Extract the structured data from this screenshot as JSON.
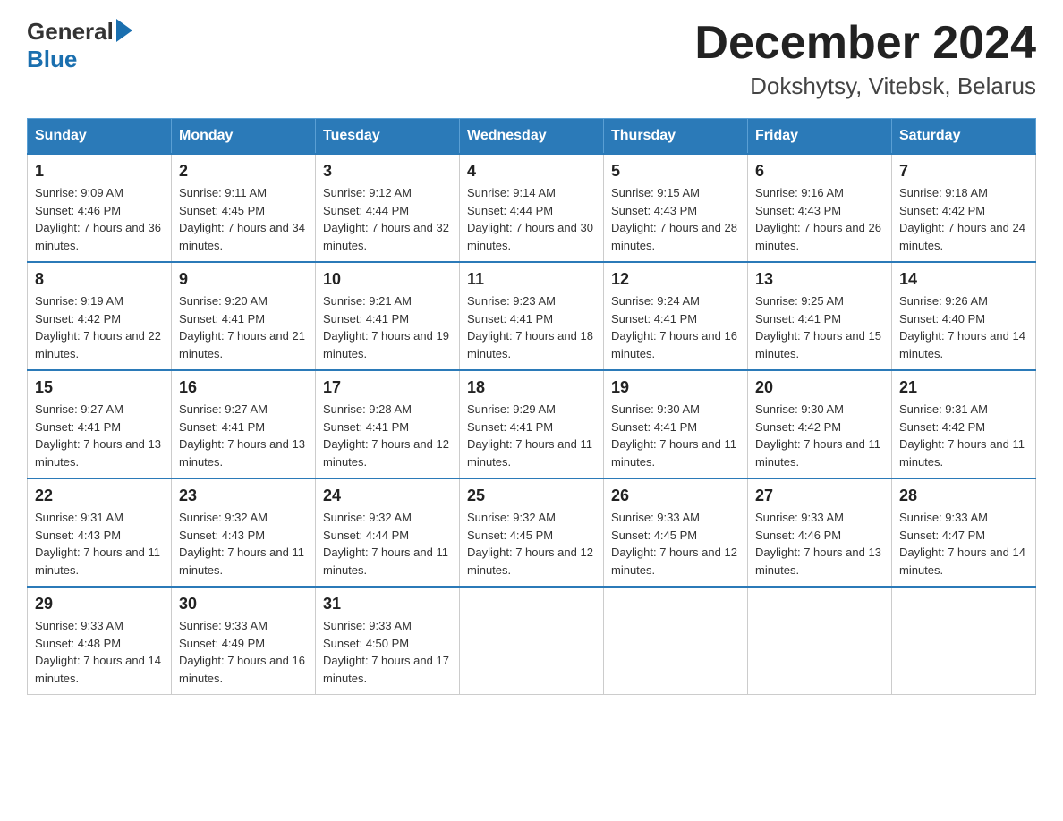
{
  "header": {
    "logo": {
      "general": "General",
      "blue": "Blue"
    },
    "month": "December 2024",
    "location": "Dokshytsy, Vitebsk, Belarus"
  },
  "weekdays": [
    "Sunday",
    "Monday",
    "Tuesday",
    "Wednesday",
    "Thursday",
    "Friday",
    "Saturday"
  ],
  "weeks": [
    [
      {
        "day": "1",
        "sunrise": "Sunrise: 9:09 AM",
        "sunset": "Sunset: 4:46 PM",
        "daylight": "Daylight: 7 hours and 36 minutes."
      },
      {
        "day": "2",
        "sunrise": "Sunrise: 9:11 AM",
        "sunset": "Sunset: 4:45 PM",
        "daylight": "Daylight: 7 hours and 34 minutes."
      },
      {
        "day": "3",
        "sunrise": "Sunrise: 9:12 AM",
        "sunset": "Sunset: 4:44 PM",
        "daylight": "Daylight: 7 hours and 32 minutes."
      },
      {
        "day": "4",
        "sunrise": "Sunrise: 9:14 AM",
        "sunset": "Sunset: 4:44 PM",
        "daylight": "Daylight: 7 hours and 30 minutes."
      },
      {
        "day": "5",
        "sunrise": "Sunrise: 9:15 AM",
        "sunset": "Sunset: 4:43 PM",
        "daylight": "Daylight: 7 hours and 28 minutes."
      },
      {
        "day": "6",
        "sunrise": "Sunrise: 9:16 AM",
        "sunset": "Sunset: 4:43 PM",
        "daylight": "Daylight: 7 hours and 26 minutes."
      },
      {
        "day": "7",
        "sunrise": "Sunrise: 9:18 AM",
        "sunset": "Sunset: 4:42 PM",
        "daylight": "Daylight: 7 hours and 24 minutes."
      }
    ],
    [
      {
        "day": "8",
        "sunrise": "Sunrise: 9:19 AM",
        "sunset": "Sunset: 4:42 PM",
        "daylight": "Daylight: 7 hours and 22 minutes."
      },
      {
        "day": "9",
        "sunrise": "Sunrise: 9:20 AM",
        "sunset": "Sunset: 4:41 PM",
        "daylight": "Daylight: 7 hours and 21 minutes."
      },
      {
        "day": "10",
        "sunrise": "Sunrise: 9:21 AM",
        "sunset": "Sunset: 4:41 PM",
        "daylight": "Daylight: 7 hours and 19 minutes."
      },
      {
        "day": "11",
        "sunrise": "Sunrise: 9:23 AM",
        "sunset": "Sunset: 4:41 PM",
        "daylight": "Daylight: 7 hours and 18 minutes."
      },
      {
        "day": "12",
        "sunrise": "Sunrise: 9:24 AM",
        "sunset": "Sunset: 4:41 PM",
        "daylight": "Daylight: 7 hours and 16 minutes."
      },
      {
        "day": "13",
        "sunrise": "Sunrise: 9:25 AM",
        "sunset": "Sunset: 4:41 PM",
        "daylight": "Daylight: 7 hours and 15 minutes."
      },
      {
        "day": "14",
        "sunrise": "Sunrise: 9:26 AM",
        "sunset": "Sunset: 4:40 PM",
        "daylight": "Daylight: 7 hours and 14 minutes."
      }
    ],
    [
      {
        "day": "15",
        "sunrise": "Sunrise: 9:27 AM",
        "sunset": "Sunset: 4:41 PM",
        "daylight": "Daylight: 7 hours and 13 minutes."
      },
      {
        "day": "16",
        "sunrise": "Sunrise: 9:27 AM",
        "sunset": "Sunset: 4:41 PM",
        "daylight": "Daylight: 7 hours and 13 minutes."
      },
      {
        "day": "17",
        "sunrise": "Sunrise: 9:28 AM",
        "sunset": "Sunset: 4:41 PM",
        "daylight": "Daylight: 7 hours and 12 minutes."
      },
      {
        "day": "18",
        "sunrise": "Sunrise: 9:29 AM",
        "sunset": "Sunset: 4:41 PM",
        "daylight": "Daylight: 7 hours and 11 minutes."
      },
      {
        "day": "19",
        "sunrise": "Sunrise: 9:30 AM",
        "sunset": "Sunset: 4:41 PM",
        "daylight": "Daylight: 7 hours and 11 minutes."
      },
      {
        "day": "20",
        "sunrise": "Sunrise: 9:30 AM",
        "sunset": "Sunset: 4:42 PM",
        "daylight": "Daylight: 7 hours and 11 minutes."
      },
      {
        "day": "21",
        "sunrise": "Sunrise: 9:31 AM",
        "sunset": "Sunset: 4:42 PM",
        "daylight": "Daylight: 7 hours and 11 minutes."
      }
    ],
    [
      {
        "day": "22",
        "sunrise": "Sunrise: 9:31 AM",
        "sunset": "Sunset: 4:43 PM",
        "daylight": "Daylight: 7 hours and 11 minutes."
      },
      {
        "day": "23",
        "sunrise": "Sunrise: 9:32 AM",
        "sunset": "Sunset: 4:43 PM",
        "daylight": "Daylight: 7 hours and 11 minutes."
      },
      {
        "day": "24",
        "sunrise": "Sunrise: 9:32 AM",
        "sunset": "Sunset: 4:44 PM",
        "daylight": "Daylight: 7 hours and 11 minutes."
      },
      {
        "day": "25",
        "sunrise": "Sunrise: 9:32 AM",
        "sunset": "Sunset: 4:45 PM",
        "daylight": "Daylight: 7 hours and 12 minutes."
      },
      {
        "day": "26",
        "sunrise": "Sunrise: 9:33 AM",
        "sunset": "Sunset: 4:45 PM",
        "daylight": "Daylight: 7 hours and 12 minutes."
      },
      {
        "day": "27",
        "sunrise": "Sunrise: 9:33 AM",
        "sunset": "Sunset: 4:46 PM",
        "daylight": "Daylight: 7 hours and 13 minutes."
      },
      {
        "day": "28",
        "sunrise": "Sunrise: 9:33 AM",
        "sunset": "Sunset: 4:47 PM",
        "daylight": "Daylight: 7 hours and 14 minutes."
      }
    ],
    [
      {
        "day": "29",
        "sunrise": "Sunrise: 9:33 AM",
        "sunset": "Sunset: 4:48 PM",
        "daylight": "Daylight: 7 hours and 14 minutes."
      },
      {
        "day": "30",
        "sunrise": "Sunrise: 9:33 AM",
        "sunset": "Sunset: 4:49 PM",
        "daylight": "Daylight: 7 hours and 16 minutes."
      },
      {
        "day": "31",
        "sunrise": "Sunrise: 9:33 AM",
        "sunset": "Sunset: 4:50 PM",
        "daylight": "Daylight: 7 hours and 17 minutes."
      },
      null,
      null,
      null,
      null
    ]
  ]
}
